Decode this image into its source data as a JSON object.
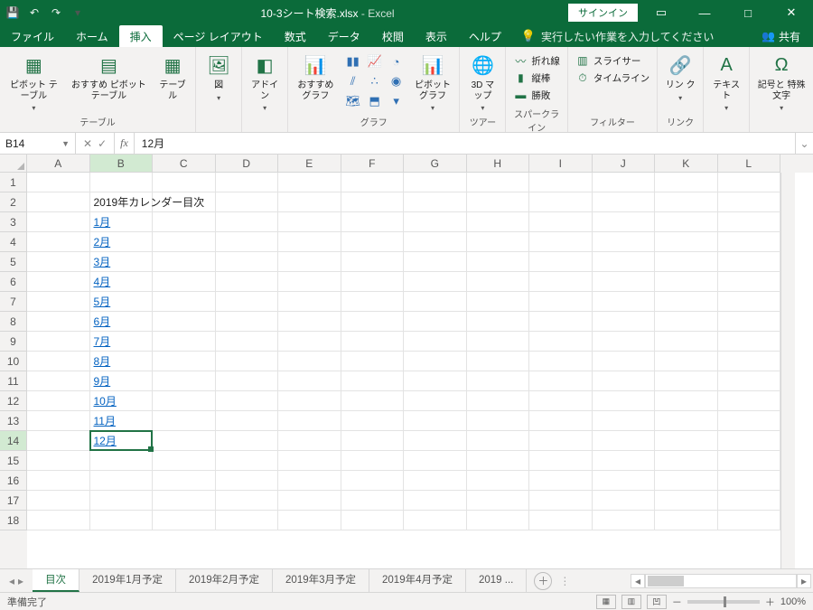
{
  "titlebar": {
    "filename": "10-3シート検索.xlsx",
    "appname": "Excel",
    "signin": "サインイン"
  },
  "tabs": {
    "file": "ファイル",
    "home": "ホーム",
    "insert": "挿入",
    "layout": "ページ レイアウト",
    "formulas": "数式",
    "data": "データ",
    "review": "校閲",
    "view": "表示",
    "help": "ヘルプ",
    "tellme": "実行したい作業を入力してください",
    "share": "共有"
  },
  "ribbon": {
    "pivot": "ピボット\nテーブル",
    "recpivot": "おすすめ\nピボットテーブル",
    "table": "テーブル",
    "g_table": "テーブル",
    "img": "図",
    "g_illust": "",
    "addin": "アドイ\nン",
    "recchart": "おすすめ\nグラフ",
    "pivotchart": "ピボットグラフ",
    "g_chart": "グラフ",
    "map3d": "3D\nマップ",
    "g_tour": "ツアー",
    "sp_line": "折れ線",
    "sp_col": "縦棒",
    "sp_wl": "勝敗",
    "g_spark": "スパークライン",
    "slicer": "スライサー",
    "timeline": "タイムライン",
    "g_filter": "フィルター",
    "link": "リン\nク",
    "g_link": "リンク",
    "text": "テキスト",
    "symbol": "記号と\n特殊文字",
    "g_symbol": ""
  },
  "fbar": {
    "namebox": "B14",
    "formula": "12月"
  },
  "columns": [
    "A",
    "B",
    "C",
    "D",
    "E",
    "F",
    "G",
    "H",
    "I",
    "J",
    "K",
    "L"
  ],
  "rows": [
    "1",
    "2",
    "3",
    "4",
    "5",
    "6",
    "7",
    "8",
    "9",
    "10",
    "11",
    "12",
    "13",
    "14",
    "15",
    "16",
    "17",
    "18"
  ],
  "cells": {
    "title": "2019年カレンダー目次",
    "m1": "1月",
    "m2": "2月",
    "m3": "3月",
    "m4": "4月",
    "m5": "5月",
    "m6": "6月",
    "m7": "7月",
    "m8": "8月",
    "m9": "9月",
    "m10": "10月",
    "m11": "11月",
    "m12": "12月"
  },
  "sheets": {
    "s1": "目次",
    "s2": "2019年1月予定",
    "s3": "2019年2月予定",
    "s4": "2019年3月予定",
    "s5": "2019年4月予定",
    "s6": "2019 ..."
  },
  "status": {
    "ready": "準備完了",
    "zoom": "100%"
  }
}
